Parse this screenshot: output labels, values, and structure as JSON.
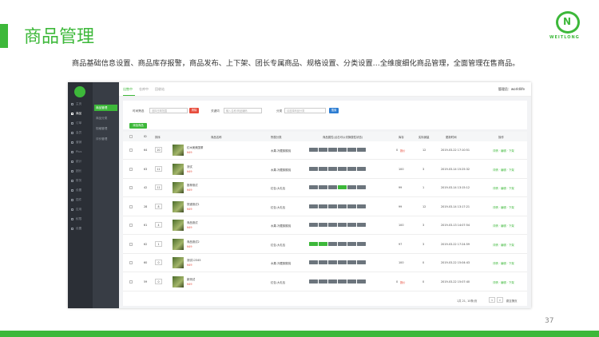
{
  "slide": {
    "title": "商品管理",
    "subtitle": "商品基础信息设置、商品库存报警，商品发布、上下架、团长专属商品、规格设置、分类设置…全维度细化商品管理，全面管理在售商品。",
    "page_number": "37",
    "brand_text": "WEITLONG",
    "accent_color": "#3db83a"
  },
  "app": {
    "sidebar": [
      "主页",
      "商品",
      "订单",
      "会员",
      "营销",
      "Plus",
      "统计",
      "团长",
      "财务",
      "设置",
      "插件",
      "应用",
      "权限",
      "设置"
    ],
    "subnav": [
      "商品管理",
      "商品分类",
      "规格管理",
      "评价管理"
    ],
    "tabs": [
      "出售中",
      "仓库中",
      "回收站"
    ],
    "admin": "管理员：worldlife",
    "filter": {
      "time_label": "时间筛选",
      "time_placeholder": "选择日期范围",
      "clear": "清除",
      "keyword_label": "关键词",
      "keyword_placeholder": "输入名称/商品编码",
      "category_label": "分类",
      "category_value": "请选择商品分类",
      "search": "搜索",
      "add": "添加商品"
    },
    "columns": [
      "ID",
      "排序",
      "商品名称",
      "所属分类",
      "商品属性(点击可以切换属性状态)",
      "库存",
      "实际销量",
      "更新时间",
      "操作"
    ],
    "rows": [
      {
        "id": "64",
        "sort": "20",
        "name": "红木美美国董",
        "price": "¥49",
        "cat": "水果-冷藏猕猴桃",
        "stock": "0",
        "stock_alert": "报价",
        "sold": "12",
        "time": "2019-03-22 17:10:51",
        "actions": "详情 · 编辑 · 下架",
        "tags": [
          0,
          0,
          0,
          0,
          0,
          0
        ]
      },
      {
        "id": "63",
        "sort": "11",
        "name": "测试",
        "price": "¥49",
        "cat": "水果-冷藏猕猴桃",
        "stock": "100",
        "stock_alert": "",
        "sold": "3",
        "time": "2019-03-14 15:25:32",
        "actions": "详情 · 编辑 · 下架",
        "tags": [
          0,
          0,
          0,
          0,
          0,
          0
        ]
      },
      {
        "id": "42",
        "sort": "11",
        "name": "推荐测试",
        "price": "¥49",
        "cat": "红包-大礼包",
        "stock": "99",
        "stock_alert": "",
        "sold": "1",
        "time": "2019-03-14 13:15:12",
        "actions": "详情 · 编辑 · 下架",
        "tags": [
          0,
          0,
          0,
          1,
          0,
          0
        ]
      },
      {
        "id": "28",
        "sort": "8",
        "name": "快递测试1",
        "price": "¥49",
        "cat": "红包-大礼包",
        "stock": "99",
        "stock_alert": "",
        "sold": "12",
        "time": "2019-03-14 13:17:21",
        "actions": "详情 · 编辑 · 下架",
        "tags": [
          0,
          0,
          0,
          0,
          0,
          0
        ]
      },
      {
        "id": "61",
        "sort": "4",
        "name": "商品测试",
        "price": "¥49",
        "cat": "水果-冷藏猕猴桃",
        "stock": "100",
        "stock_alert": "",
        "sold": "3",
        "time": "2019-03-13 14:07:54",
        "actions": "详情 · 编辑 · 下架",
        "tags": [
          0,
          0,
          0,
          0,
          0,
          0
        ]
      },
      {
        "id": "62",
        "sort": "1",
        "name": "商品测试2",
        "price": "¥49",
        "cat": "红包-大礼包",
        "stock": "97",
        "stock_alert": "",
        "sold": "3",
        "time": "2019-03-22 17:24:59",
        "actions": "详情 · 编辑 · 下架",
        "tags": [
          1,
          1,
          0,
          0,
          0,
          0
        ]
      },
      {
        "id": "60",
        "sort": "0",
        "name": "测试12345",
        "price": "¥49",
        "cat": "水果-冷藏猕猴桃",
        "stock": "100",
        "stock_alert": "",
        "sold": "0",
        "time": "2019-03-22 15:04:43",
        "actions": "详情 · 编辑 · 下架",
        "tags": [
          0,
          0,
          0,
          0,
          0,
          0
        ]
      },
      {
        "id": "59",
        "sort": "0",
        "name": "新测试",
        "price": "¥49",
        "cat": "红包-大礼包",
        "stock": "0",
        "stock_alert": "报价",
        "sold": "0",
        "time": "2019-03-22 15:07:40",
        "actions": "详情 · 编辑 · 下架",
        "tags": [
          0,
          0,
          0,
          0,
          0,
          0
        ]
      }
    ],
    "pager": {
      "summary": "1共 21, 10条/页",
      "prev": "<",
      "next": ">",
      "jump": "跳至第页"
    }
  }
}
